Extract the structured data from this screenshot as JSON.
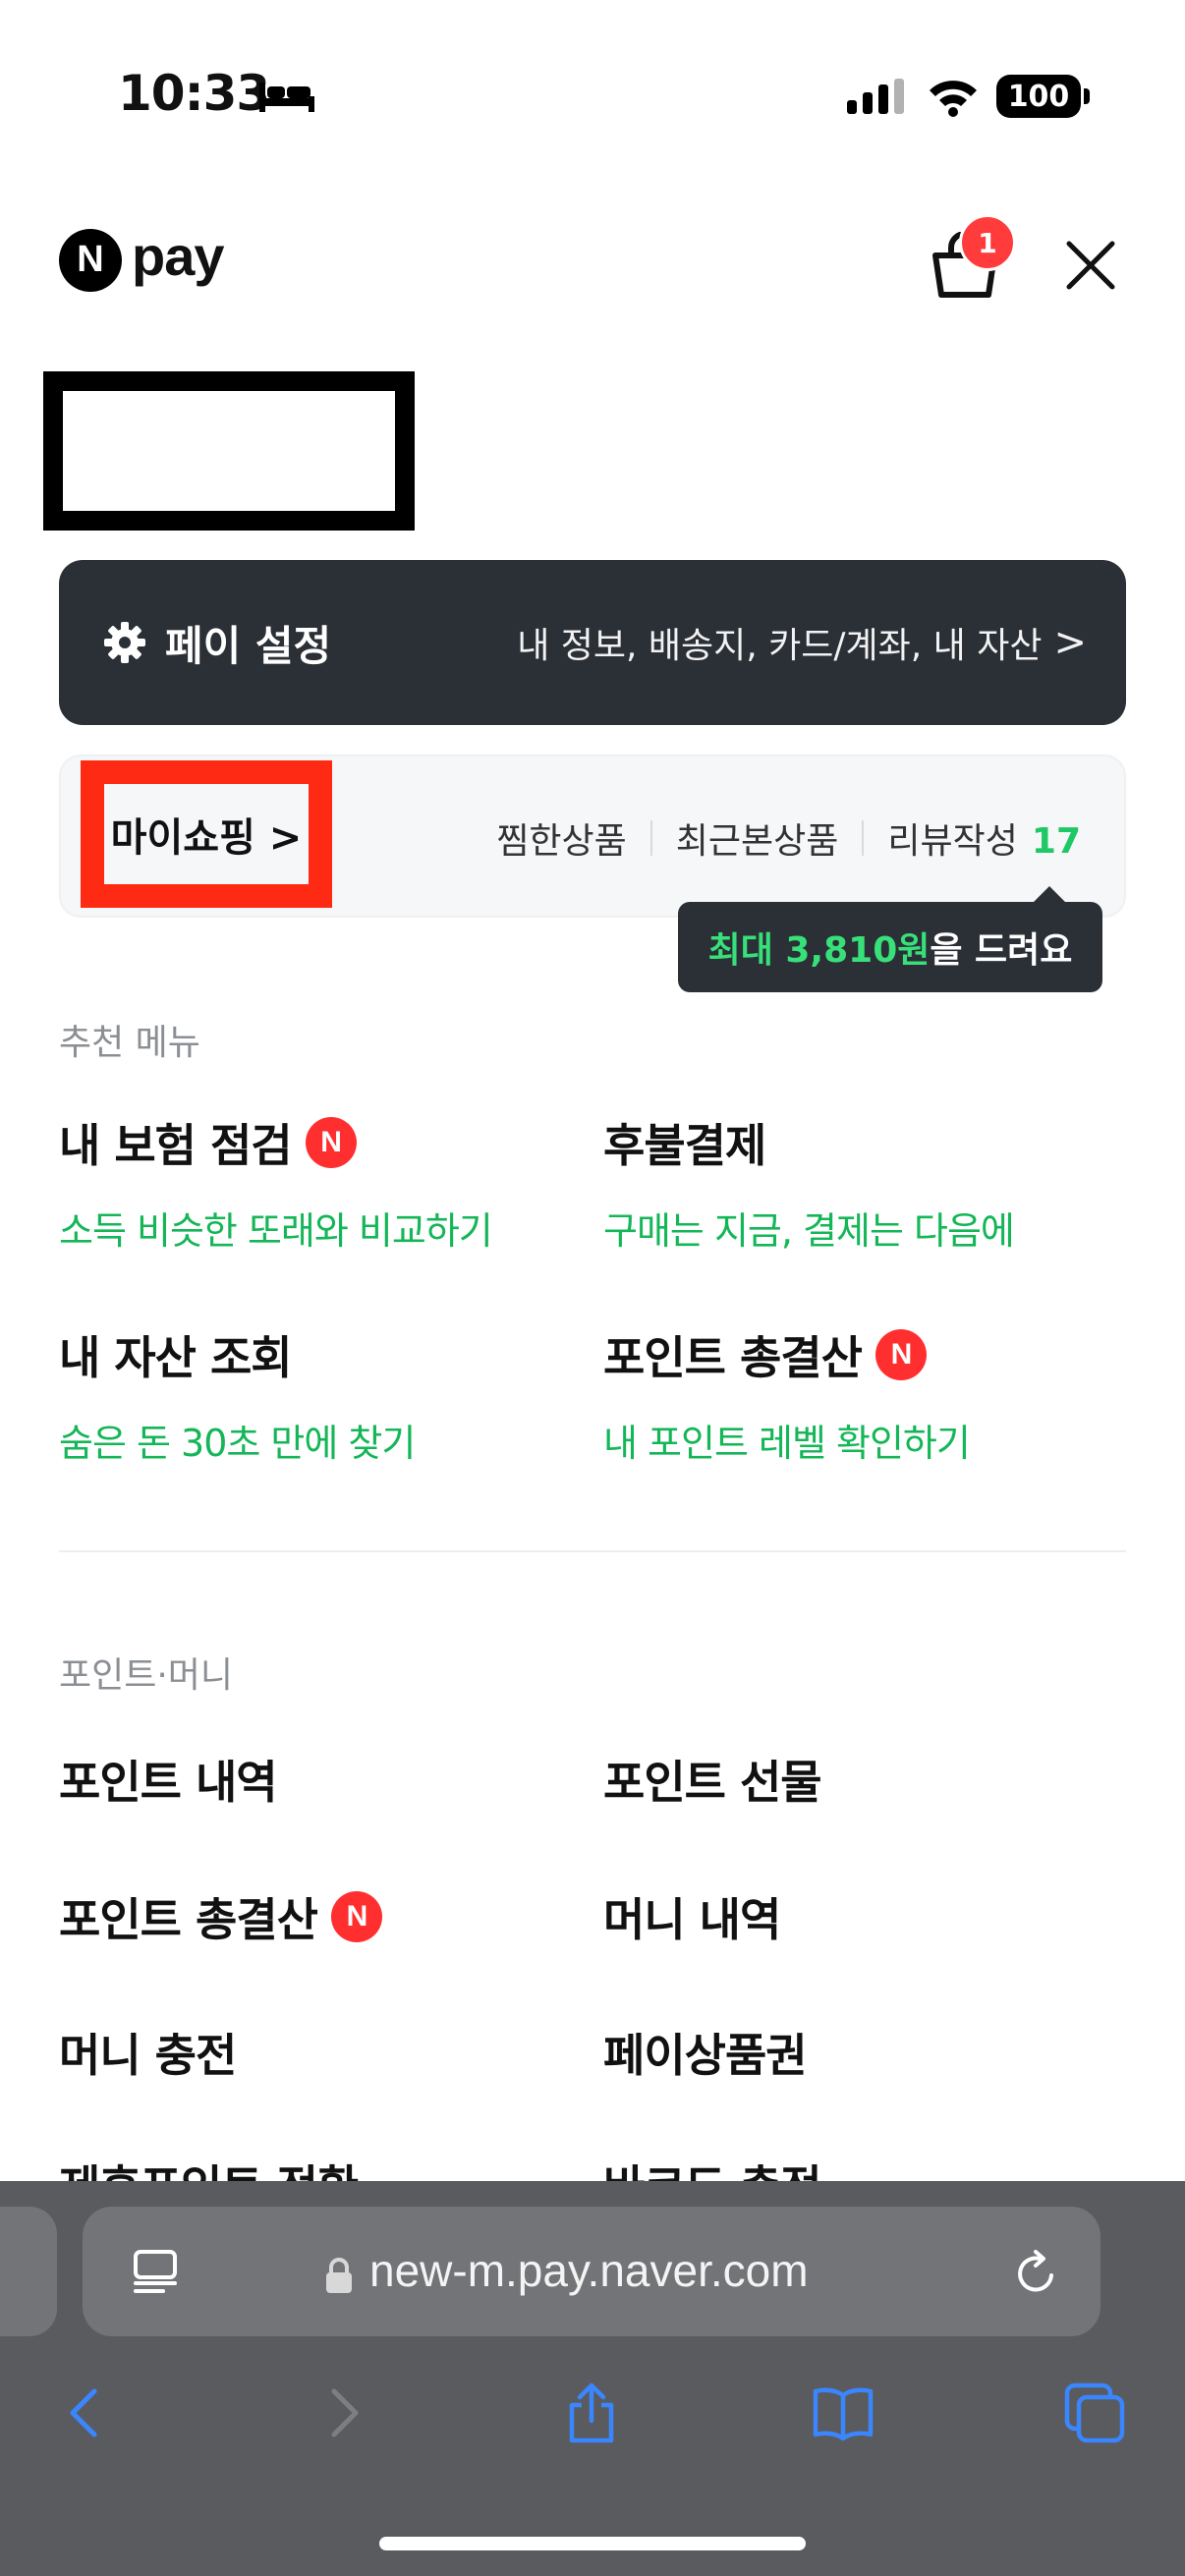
{
  "status_bar": {
    "time": "10:33",
    "battery": "100"
  },
  "header": {
    "logo_n": "N",
    "logo_pay": "pay",
    "cart_count": "1"
  },
  "pay_settings": {
    "title": "페이 설정",
    "links": "내 정보, 배송지, 카드/계좌, 내 자산",
    "chevron": ">"
  },
  "my_shopping": {
    "title": "마이쇼핑 >",
    "wishlist": "찜한상품",
    "recent": "최근본상품",
    "review": "리뷰작성",
    "review_count": "17",
    "tooltip_highlight": "최대 3,810원",
    "tooltip_rest": "을 드려요"
  },
  "recommended": {
    "label": "추천 메뉴",
    "items": [
      {
        "title": "내 보험 점검",
        "sub": "소득 비슷한 또래와 비교하기",
        "badge": "N"
      },
      {
        "title": "후불결제",
        "sub": "구매는 지금, 결제는 다음에"
      },
      {
        "title": "내 자산 조회",
        "sub": "숨은 돈 30초 만에 찾기"
      },
      {
        "title": "포인트 총결산",
        "sub": "내 포인트 레벨 확인하기",
        "badge": "N"
      }
    ]
  },
  "points_money": {
    "label": "포인트·머니",
    "items": [
      {
        "title": "포인트 내역"
      },
      {
        "title": "포인트 선물"
      },
      {
        "title": "포인트 총결산",
        "badge": "N"
      },
      {
        "title": "머니 내역"
      },
      {
        "title": "머니 충전"
      },
      {
        "title": "페이상품권"
      },
      {
        "title": "제휴포인트 전환"
      },
      {
        "title": "바코드 충전"
      }
    ]
  },
  "browser": {
    "url": "new-m.pay.naver.com"
  }
}
